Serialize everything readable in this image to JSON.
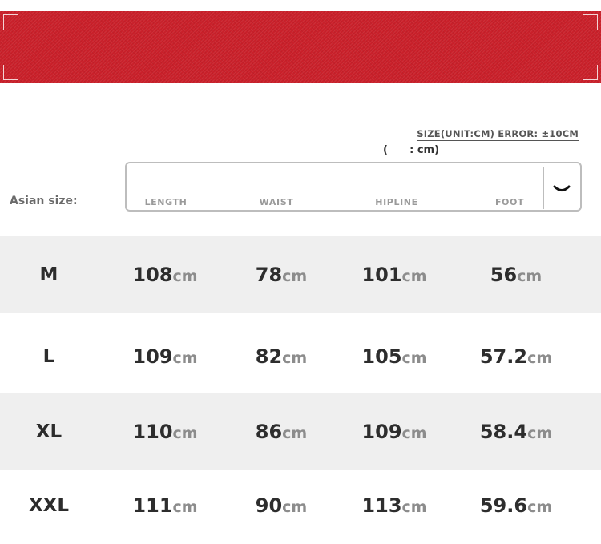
{
  "colors": {
    "banner": "#c9202a",
    "row_shade": "#efefef"
  },
  "notes": {
    "size_note": "SIZE(UNIT:CM) ERROR: ±10CM",
    "unit_note": "(      : cm)"
  },
  "header": {
    "row_label": "Asian size:",
    "columns": [
      "LENGTH",
      "WAIST",
      "HIPLINE",
      "FOOT"
    ],
    "toggle_icon": "chevron-down-icon"
  },
  "table": {
    "unit": "cm",
    "rows": [
      {
        "size": "M",
        "values": [
          "108",
          "78",
          "101",
          "56"
        ]
      },
      {
        "size": "L",
        "values": [
          "109",
          "82",
          "105",
          "57.2"
        ]
      },
      {
        "size": "XL",
        "values": [
          "110",
          "86",
          "109",
          "58.4"
        ]
      },
      {
        "size": "XXL",
        "values": [
          "111",
          "90",
          "113",
          "59.6"
        ]
      }
    ]
  }
}
